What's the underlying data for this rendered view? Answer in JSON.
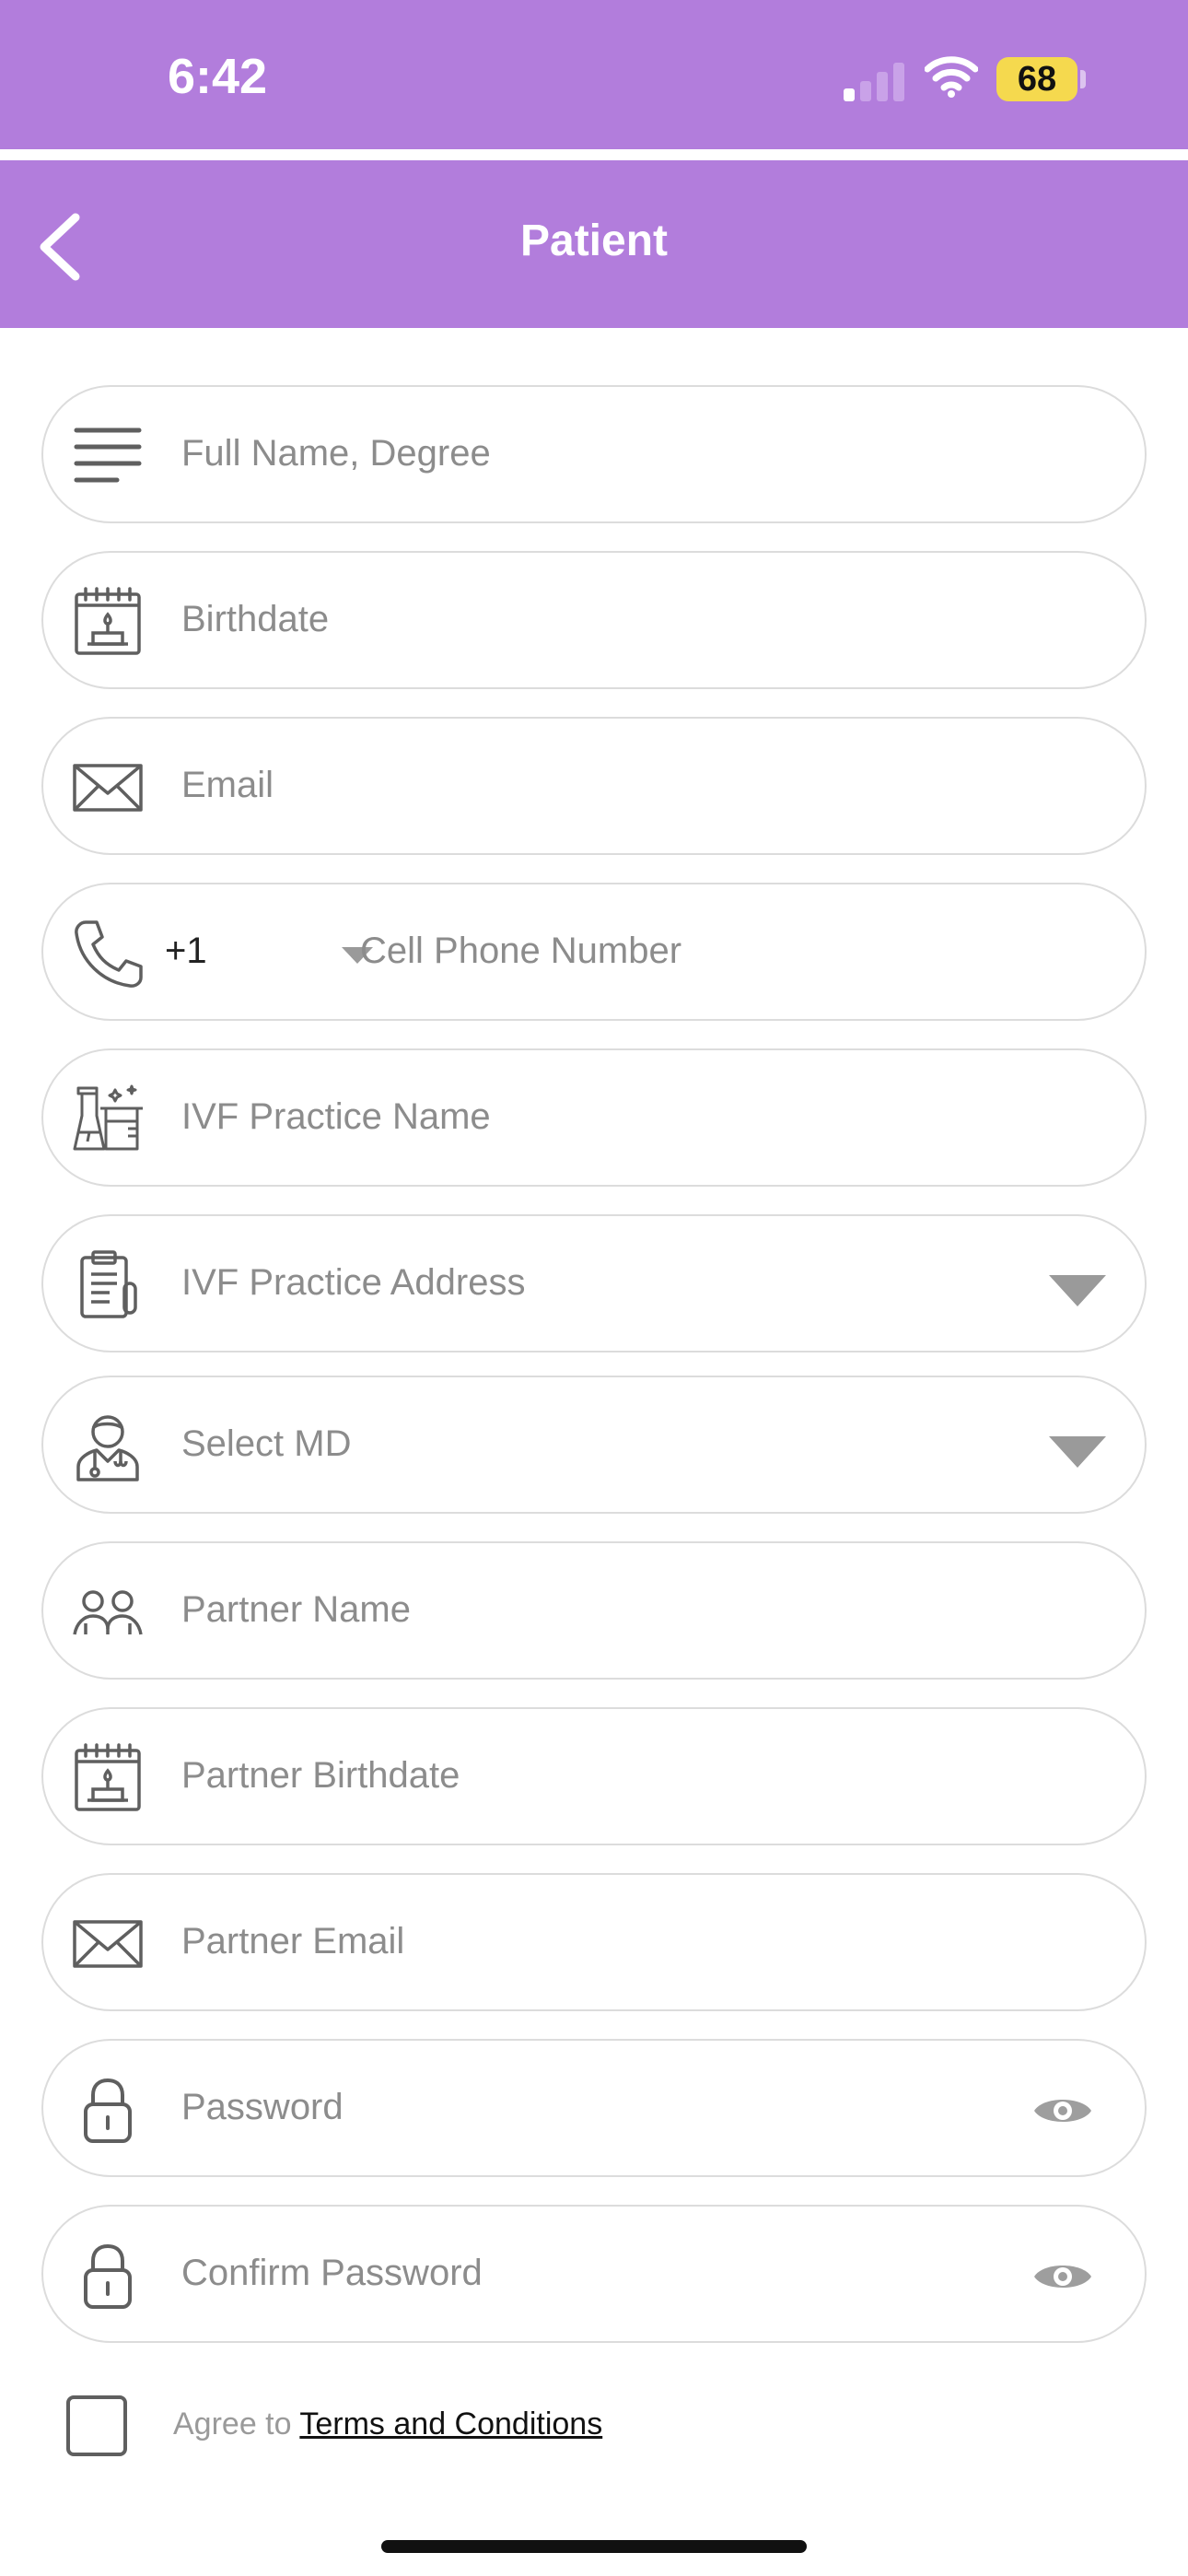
{
  "status_bar": {
    "time": "6:42",
    "battery": "68",
    "background": "#b27ddc"
  },
  "nav": {
    "title": "Patient",
    "back_icon": "chevron-left-icon"
  },
  "form": {
    "full_name": {
      "placeholder": "Full Name, Degree",
      "icon": "menu-lines-icon"
    },
    "birthdate": {
      "placeholder": "Birthdate",
      "icon": "birthday-calendar-icon"
    },
    "email": {
      "placeholder": "Email",
      "icon": "envelope-icon"
    },
    "phone": {
      "country_code": "+1",
      "placeholder": "Cell Phone Number",
      "icon": "phone-icon"
    },
    "practice_name": {
      "placeholder": "IVF Practice Name",
      "icon": "lab-flask-icon"
    },
    "practice_address": {
      "placeholder": "IVF Practice Address",
      "icon": "clipboard-icon"
    },
    "md": {
      "placeholder": "Select MD",
      "icon": "doctor-icon"
    },
    "partner_name": {
      "placeholder": "Partner Name",
      "icon": "people-icon"
    },
    "partner_birthdate": {
      "placeholder": "Partner Birthdate",
      "icon": "birthday-calendar-icon"
    },
    "partner_email": {
      "placeholder": "Partner Email",
      "icon": "envelope-icon"
    },
    "password": {
      "placeholder": "Password",
      "icon": "lock-icon"
    },
    "confirm_password": {
      "placeholder": "Confirm Password",
      "icon": "lock-icon"
    }
  },
  "terms": {
    "prefix": "Agree to",
    "link": "Terms and Conditions",
    "checked": false
  }
}
